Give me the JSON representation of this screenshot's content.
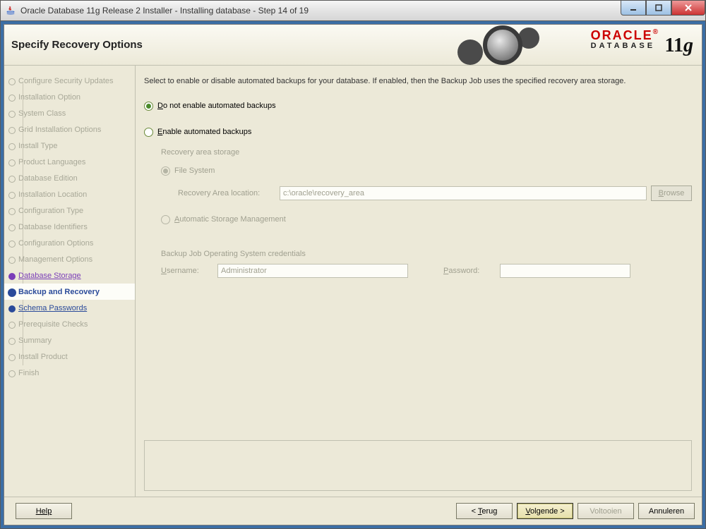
{
  "window": {
    "title": "Oracle Database 11g Release 2 Installer - Installing database - Step 14 of 19"
  },
  "header": {
    "title": "Specify Recovery Options",
    "logo_brand": "ORACLE",
    "logo_sub": "DATABASE",
    "logo_version": "11g"
  },
  "sidebar": {
    "items": [
      {
        "label": "Configure Security Updates",
        "state": "done"
      },
      {
        "label": "Installation Option",
        "state": "done"
      },
      {
        "label": "System Class",
        "state": "done"
      },
      {
        "label": "Grid Installation Options",
        "state": "done"
      },
      {
        "label": "Install Type",
        "state": "done"
      },
      {
        "label": "Product Languages",
        "state": "done"
      },
      {
        "label": "Database Edition",
        "state": "done"
      },
      {
        "label": "Installation Location",
        "state": "done"
      },
      {
        "label": "Configuration Type",
        "state": "done"
      },
      {
        "label": "Database Identifiers",
        "state": "done"
      },
      {
        "label": "Configuration Options",
        "state": "done"
      },
      {
        "label": "Management Options",
        "state": "done"
      },
      {
        "label": "Database Storage",
        "state": "visited"
      },
      {
        "label": "Backup and Recovery",
        "state": "current"
      },
      {
        "label": "Schema Passwords",
        "state": "next"
      },
      {
        "label": "Prerequisite Checks",
        "state": "todo"
      },
      {
        "label": "Summary",
        "state": "todo"
      },
      {
        "label": "Install Product",
        "state": "todo"
      },
      {
        "label": "Finish",
        "state": "todo"
      }
    ]
  },
  "main": {
    "intro": "Select to enable or disable automated backups for your database. If enabled, then the Backup Job uses the specified recovery area storage.",
    "opt_disable": "Do not enable automated backups",
    "opt_enable": "Enable automated backups",
    "section_storage": "Recovery area storage",
    "opt_fs": "File System",
    "recovery_label": "Recovery Area location:",
    "recovery_value": "c:\\oracle\\recovery_area",
    "browse": "Browse",
    "opt_asm": "Automatic Storage Management",
    "section_creds": "Backup Job Operating System credentials",
    "username_label": "Username:",
    "username_value": "Administrator",
    "password_label": "Password:",
    "password_value": ""
  },
  "footer": {
    "help": "Help",
    "back": "< Terug",
    "next": "Volgende >",
    "finish": "Voltooien",
    "cancel": "Annuleren"
  }
}
